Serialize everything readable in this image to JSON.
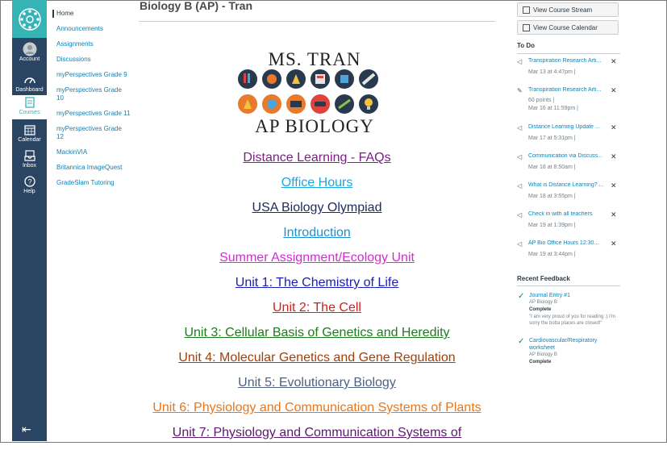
{
  "global_nav": {
    "account": "Account",
    "dashboard": "Dashboard",
    "courses": "Courses",
    "calendar": "Calendar",
    "inbox": "Inbox",
    "help": "Help"
  },
  "course_nav": [
    "Home",
    "Announcements",
    "Assignments",
    "Discussions",
    "myPerspectives Grade 9",
    "myPerspectives Grade 10",
    "myPerspectives Grade 11",
    "myPerspectives Grade 12",
    "MackinVIA",
    "Britannica ImageQuest",
    "GradeSlam Tutoring"
  ],
  "page": {
    "title": "Biology B (AP) - Tran",
    "banner_top": "MS. TRAN",
    "banner_bottom": "AP BIOLOGY"
  },
  "links": [
    {
      "label": "Distance Learning - FAQs",
      "color": "#7b1f86"
    },
    {
      "label": "Office Hours",
      "color": "#1aa7e0"
    },
    {
      "label": "USA Biology Olympiad",
      "color": "#1c2a5e"
    },
    {
      "label": "Introduction",
      "color": "#1f8fd1"
    },
    {
      "label": " Summer Assignment/Ecology Unit",
      "color": "#d62ad9"
    },
    {
      "label": "Unit 1: The Chemistry of Life",
      "color": "#1b20b8"
    },
    {
      "label": "Unit 2: The Cell",
      "color": "#d21f1f"
    },
    {
      "label": "Unit 3: Cellular Basis of Genetics and Heredity",
      "color": "#1e7b1e"
    },
    {
      "label": "Unit 4: Molecular Genetics and Gene Regulation",
      "color": "#a0410d"
    },
    {
      "label": "Unit 5: Evolutionary Biology",
      "color": "#4f6180"
    },
    {
      "label": "Unit 6: Physiology and Communication Systems of Plants",
      "color": "#e8761b"
    },
    {
      "label": "Unit 7: Physiology and Communication Systems of",
      "color": "#5a1a6e"
    }
  ],
  "sidebar": {
    "view_stream": "View Course Stream",
    "view_calendar": "View Course Calendar",
    "todo_heading": "To Do",
    "todo": [
      {
        "title": "Transpiration Research Arti...",
        "meta": "Mar 13 at 4:47pm  |",
        "icon": "megaphone-icon"
      },
      {
        "title": "Transpiration Research Arti...",
        "points": "60 points  |",
        "meta": "Mar 16 at 11:59pm  |",
        "icon": "assignment-icon"
      },
      {
        "title": "Distance Learning Update ...",
        "meta": "Mar 17 at 5:31pm  |",
        "icon": "megaphone-icon"
      },
      {
        "title": "Communication via Discuss...",
        "meta": "Mar 18 at 8:50am  |",
        "icon": "megaphone-icon"
      },
      {
        "title": "What is Distance Learning? ...",
        "meta": "Mar 18 at 3:55pm  |",
        "icon": "megaphone-icon"
      },
      {
        "title": "Check in with all teachers",
        "meta": "Mar 19 at 1:39pm  |",
        "icon": "megaphone-icon"
      },
      {
        "title": "AP Bio Office Hours 12:30...",
        "meta": "Mar 19 at 3:44pm  |",
        "icon": "megaphone-icon"
      }
    ],
    "feedback_heading": "Recent Feedback",
    "feedback": [
      {
        "title": "Journal Entry #1",
        "course": "AP Biology B",
        "status": "Complete",
        "quote": "\"I am very proud of you for reading :) I'm sorry the boba places are closed!\""
      },
      {
        "title": "Cardiovascular/Respiratory worksheet",
        "course": "AP Biology B",
        "status": "Complete"
      }
    ]
  }
}
